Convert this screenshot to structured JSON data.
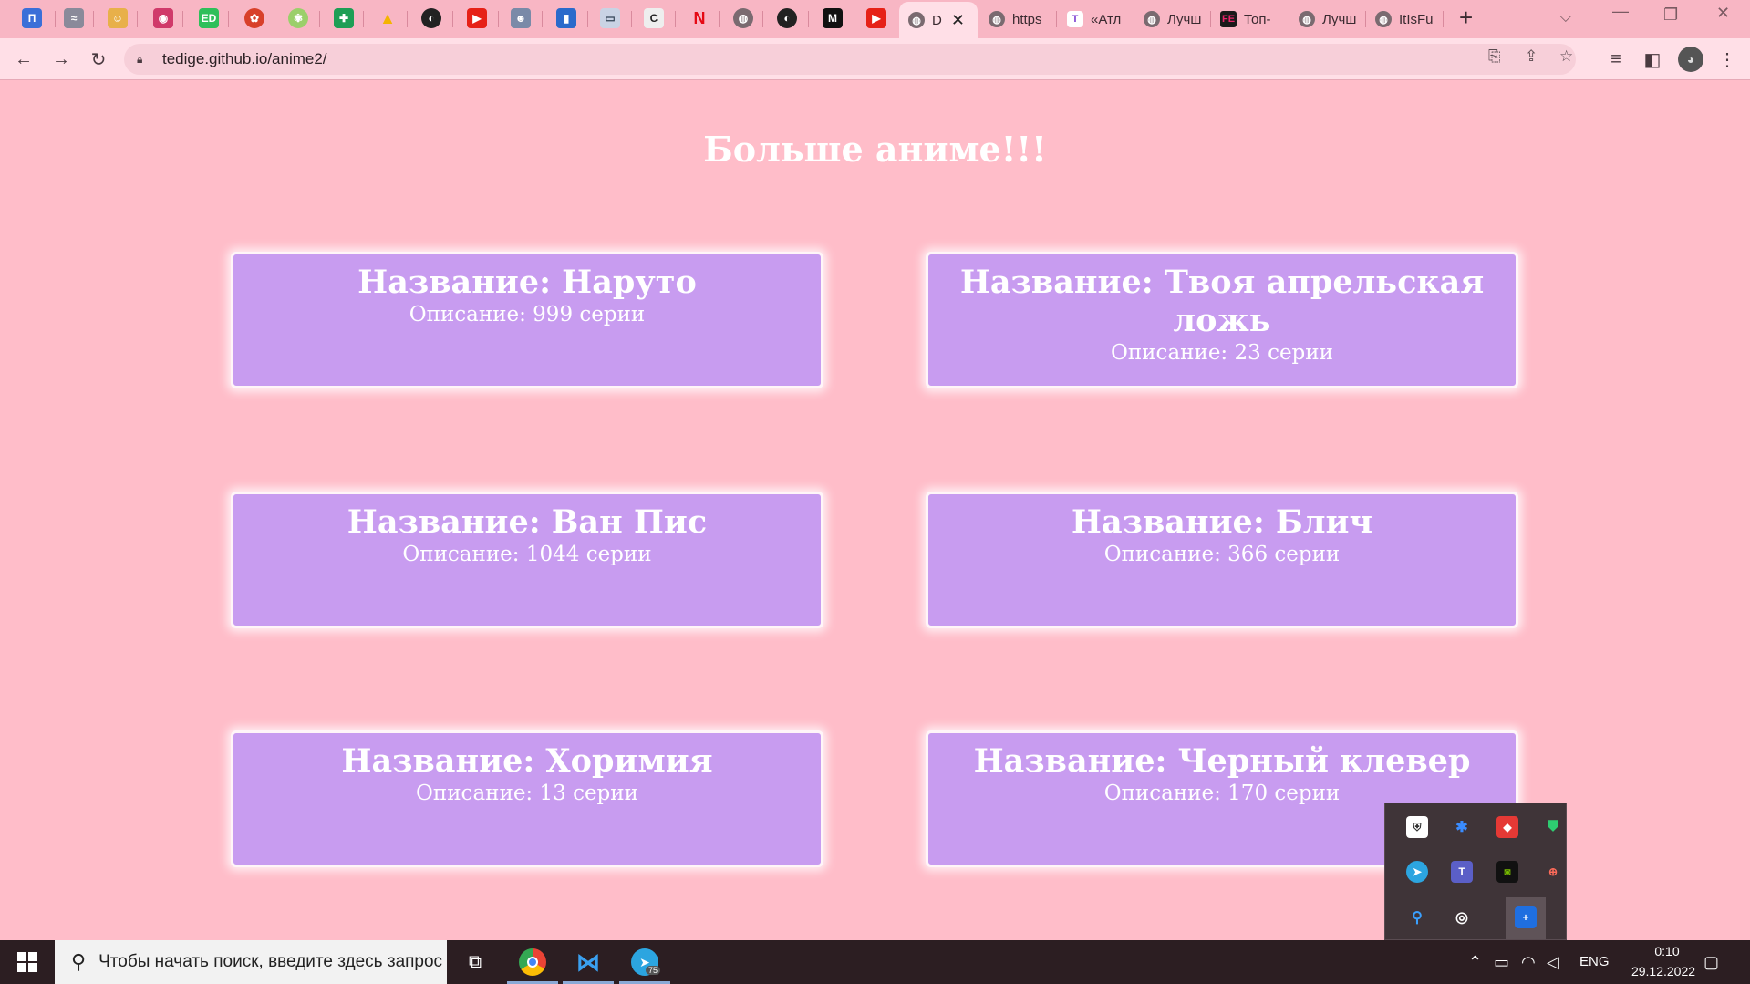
{
  "browser": {
    "tabs": [
      {
        "label": "D",
        "active": true
      },
      {
        "label": "https"
      },
      {
        "label": "«Атл"
      },
      {
        "label": "Лучш"
      },
      {
        "label": "Топ-"
      },
      {
        "label": "Лучш"
      },
      {
        "label": "ItIsFu"
      }
    ],
    "pinned_icons": [
      "tab-icon-1",
      "tab-icon-2",
      "tab-icon-3",
      "tab-icon-4",
      "ED",
      "tab-icon-6",
      "tab-icon-7",
      "sheets-icon",
      "drive-icon",
      "github-icon",
      "youtube-icon",
      "tab-icon-12",
      "tab-icon-13",
      "tab-icon-14",
      "tab-icon-15",
      "N",
      "globe-icon",
      "github-icon",
      "M",
      "youtube-icon"
    ],
    "new_tab_label": "+",
    "url": "tedige.github.io/anime2/"
  },
  "page": {
    "title": "Больше аниме!!!",
    "cards": [
      {
        "name": "Название: Наруто",
        "desc": "Описание: 999 серии"
      },
      {
        "name": "Название: Твоя апрельская ложь",
        "desc": "Описание: 23 серии"
      },
      {
        "name": "Название: Ван Пис",
        "desc": "Описание: 1044 серии"
      },
      {
        "name": "Название: Блич",
        "desc": "Описание: 366 серии"
      },
      {
        "name": "Название: Хоримия",
        "desc": "Описание: 13 серии"
      },
      {
        "name": "Название: Черный клевер",
        "desc": "Описание: 170 серии"
      }
    ]
  },
  "taskbar": {
    "search_placeholder": "Чтобы начать поиск, введите здесь запрос",
    "telegram_badge": "75",
    "language": "ENG",
    "time": "0:10",
    "date": "29.12.2022"
  },
  "colors": {
    "page_bg": "#ffbdc9",
    "card_bg": "#c89cf0",
    "tabstrip_bg": "#f8b6c4",
    "taskbar_bg": "#2c1e22"
  }
}
